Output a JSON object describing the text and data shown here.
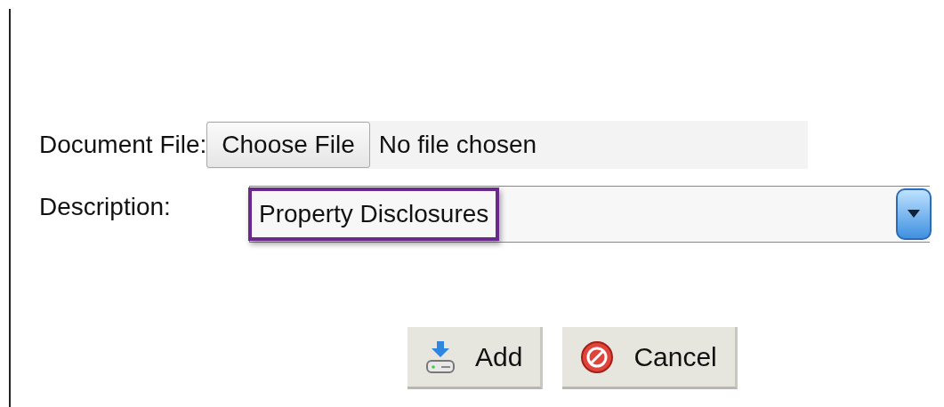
{
  "document_file": {
    "label": "Document File:",
    "button": "Choose File",
    "status": "No file chosen"
  },
  "description": {
    "label": "Description:",
    "value": "Property Disclosures",
    "highlighted": true
  },
  "buttons": [
    {
      "label": "Add",
      "kind": "add"
    },
    {
      "label": "Cancel",
      "kind": "cancel"
    }
  ]
}
